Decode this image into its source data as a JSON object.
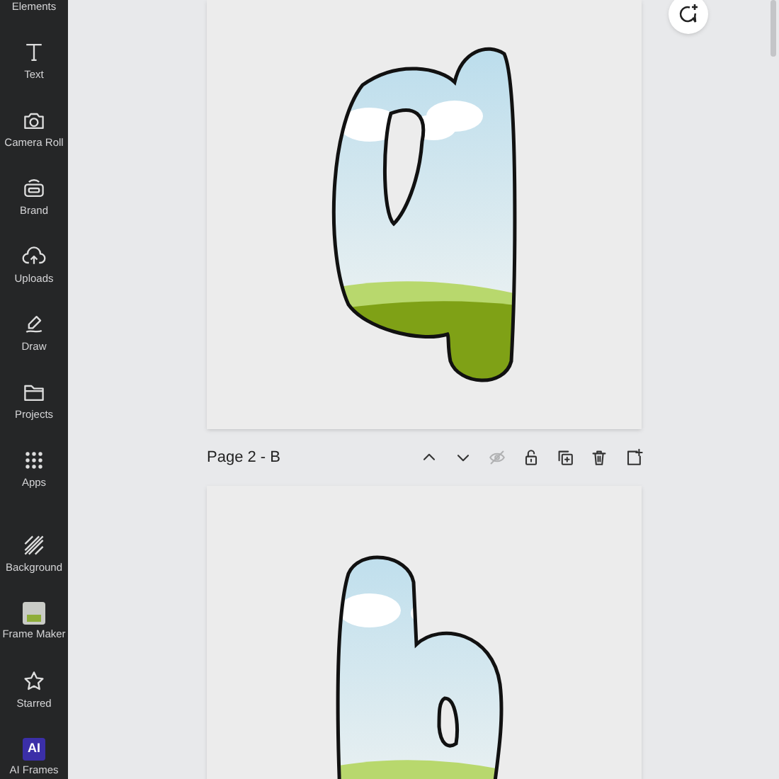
{
  "sidebar": {
    "items": [
      {
        "label": "Elements"
      },
      {
        "label": "Text"
      },
      {
        "label": "Camera Roll"
      },
      {
        "label": "Brand"
      },
      {
        "label": "Uploads"
      },
      {
        "label": "Draw"
      },
      {
        "label": "Projects"
      },
      {
        "label": "Apps"
      },
      {
        "label": "Background"
      },
      {
        "label": "Frame Maker"
      },
      {
        "label": "Starred"
      },
      {
        "label": "AI Frames",
        "badge": "AI"
      }
    ]
  },
  "page_header": {
    "title": "Page 2 - B"
  },
  "page_toolbar": {
    "actions": [
      {
        "disabled": false
      },
      {
        "disabled": false
      },
      {
        "disabled": true
      },
      {
        "disabled": false
      },
      {
        "disabled": false
      },
      {
        "disabled": false
      },
      {
        "disabled": false
      }
    ]
  }
}
